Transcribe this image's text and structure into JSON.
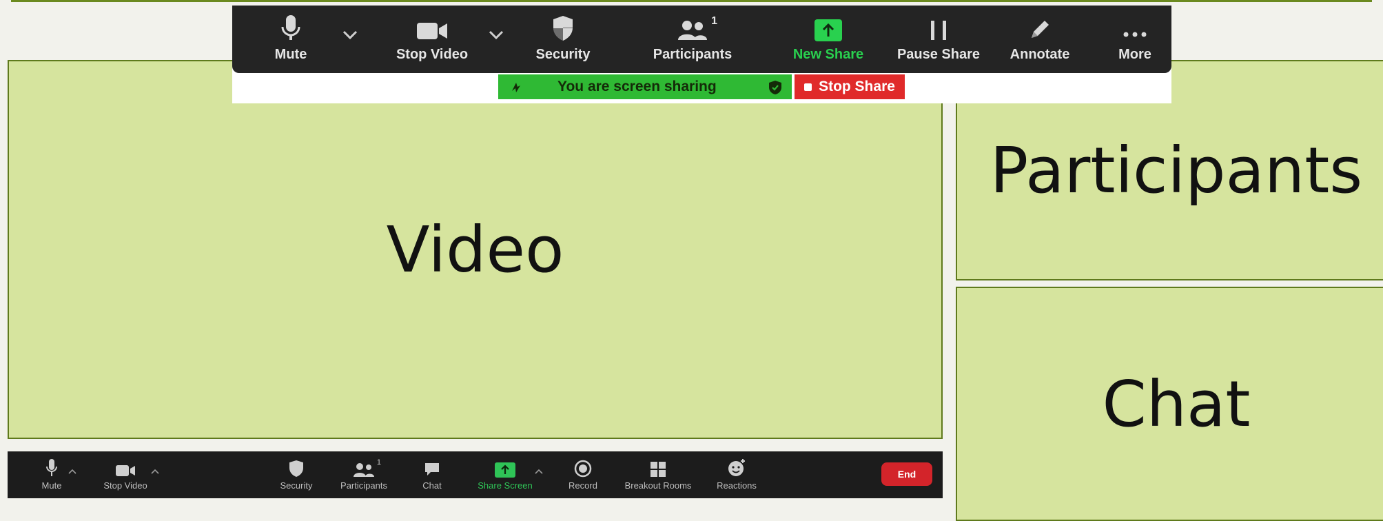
{
  "panels": {
    "video": "Video",
    "participants": "Participants",
    "chat": "Chat"
  },
  "share_toolbar": {
    "mute": "Mute",
    "stop_video": "Stop Video",
    "security": "Security",
    "participants": "Participants",
    "participants_count": "1",
    "new_share": "New Share",
    "pause_share": "Pause Share",
    "annotate": "Annotate",
    "more": "More"
  },
  "sharing_status": {
    "text": "You are screen sharing",
    "stop_label": "Stop Share"
  },
  "meeting_toolbar": {
    "mute": "Mute",
    "stop_video": "Stop Video",
    "security": "Security",
    "participants": "Participants",
    "participants_count": "1",
    "chat": "Chat",
    "share_screen": "Share Screen",
    "record": "Record",
    "breakout_rooms": "Breakout Rooms",
    "reactions": "Reactions",
    "end": "End"
  },
  "colors": {
    "panel_fill": "#d6e49e",
    "panel_border": "#5f7a1c",
    "toolbar_bg": "#242424",
    "accent_green": "#29d14f",
    "end_red": "#d3242a"
  },
  "icons": [
    "microphone-icon",
    "video-camera-icon",
    "shield-icon",
    "people-icon",
    "up-arrow-icon",
    "pause-icon",
    "pencil-icon",
    "more-dots-icon",
    "chat-bubble-icon",
    "record-icon",
    "grid-icon",
    "emoji-icon",
    "chevron-down-icon"
  ]
}
